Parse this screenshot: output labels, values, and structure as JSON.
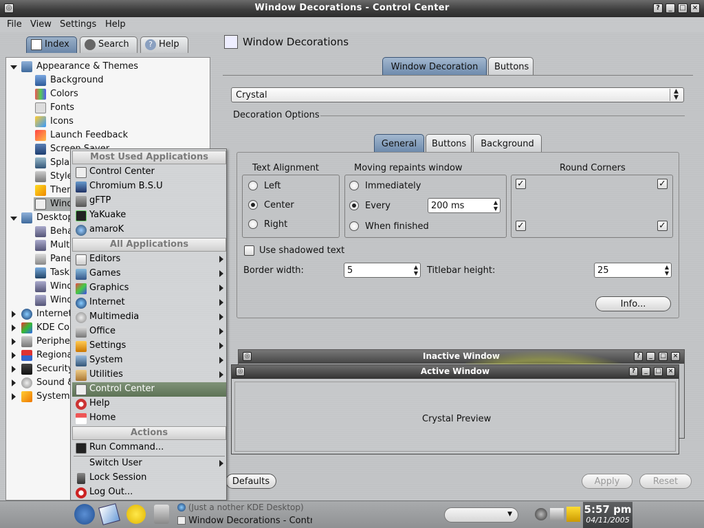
{
  "window": {
    "title": "Window Decorations - Control Center"
  },
  "menubar": {
    "file": "File",
    "view": "View",
    "settings": "Settings",
    "help": "Help"
  },
  "sidebar": {
    "tabs": {
      "index": "Index",
      "search": "Search",
      "help": "Help"
    },
    "tree": [
      {
        "label": "Appearance & Themes"
      },
      {
        "label": "Background"
      },
      {
        "label": "Colors"
      },
      {
        "label": "Fonts"
      },
      {
        "label": "Icons"
      },
      {
        "label": "Launch Feedback"
      },
      {
        "label": "Screen Saver"
      },
      {
        "label": "Splash"
      },
      {
        "label": "Style"
      },
      {
        "label": "Theme Manager"
      },
      {
        "label": "Window Decorations"
      },
      {
        "label": "Desktop"
      },
      {
        "label": "Behavior"
      },
      {
        "label": "Multiple Desktops"
      },
      {
        "label": "Panels"
      },
      {
        "label": "Taskbar"
      },
      {
        "label": "Window Behavior"
      },
      {
        "label": "Window-Specific Settings"
      },
      {
        "label": "Internet & Network"
      },
      {
        "label": "KDE Components"
      },
      {
        "label": "Peripherals"
      },
      {
        "label": "Regional & Accessibility"
      },
      {
        "label": "Security & Privacy"
      },
      {
        "label": "Sound & Multimedia"
      },
      {
        "label": "System Administration"
      }
    ]
  },
  "main": {
    "header": "Window Decorations",
    "tabs": {
      "decoration": "Window Decoration",
      "buttons": "Buttons"
    },
    "decoration_value": "Crystal",
    "decoration_options": "Decoration Options",
    "subtabs": {
      "general": "General",
      "buttons": "Buttons",
      "background": "Background"
    },
    "text_alignment": {
      "title": "Text Alignment",
      "left": "Left",
      "center": "Center",
      "right": "Right"
    },
    "repaint": {
      "title": "Moving repaints window",
      "immediately": "Immediately",
      "every": "Every",
      "every_value": "200 ms",
      "finished": "When finished"
    },
    "round_corners": {
      "title": "Round Corners"
    },
    "shadowed_text": "Use shadowed text",
    "border_width": {
      "label": "Border width:",
      "value": "5"
    },
    "titlebar_height": {
      "label": "Titlebar height:",
      "value": "25"
    },
    "info_button": "Info...",
    "preview": {
      "inactive": "Inactive Window",
      "active": "Active Window",
      "body": "Crystal Preview"
    },
    "defaults_button": "Defaults",
    "apply_button": "Apply",
    "reset_button": "Reset"
  },
  "kmenu": {
    "most_used_header": "Most Used Applications",
    "most_used": [
      "Control Center",
      "Chromium B.S.U",
      "gFTP",
      "YaKuake",
      "amaroK"
    ],
    "all_header": "All Applications",
    "all": [
      "Editors",
      "Games",
      "Graphics",
      "Internet",
      "Multimedia",
      "Office",
      "Settings",
      "System",
      "Utilities"
    ],
    "extra": [
      "Control Center",
      "Help",
      "Home"
    ],
    "actions_header": "Actions",
    "actions": [
      "Run Command...",
      "Switch User",
      "Lock Session",
      "Log Out..."
    ]
  },
  "taskbar": {
    "task1": "(Just a nother KDE Desktop)",
    "task2": "Window Decorations - Control Center",
    "time": "5:57 pm",
    "date": "04/11/2005"
  },
  "colors": {
    "accent": "#6e8bad",
    "highlight": "#5e7356",
    "titlebar": "#333333"
  }
}
